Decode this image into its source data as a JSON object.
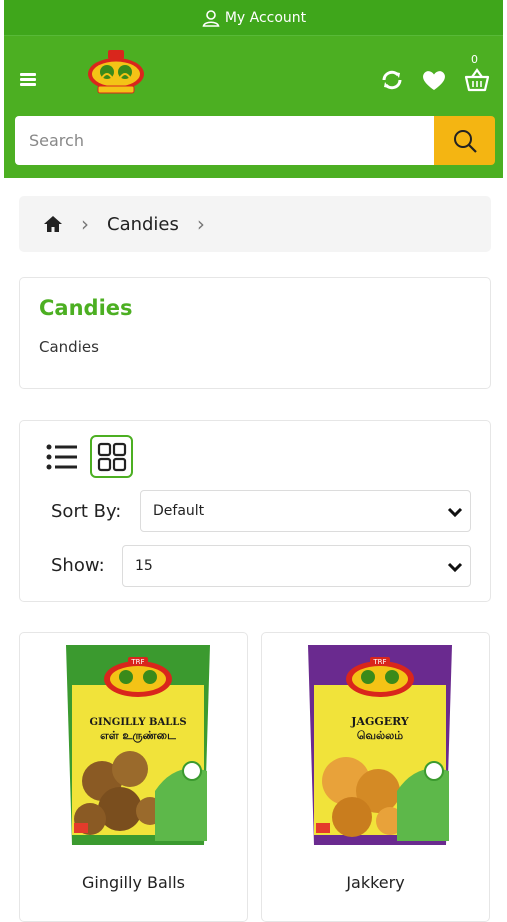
{
  "topbar": {
    "account_label": "My Account"
  },
  "header": {
    "cart_count": "0",
    "colors": {
      "brand_green": "#4caf22",
      "accent_yellow": "#f4b512"
    }
  },
  "search": {
    "placeholder": "Search"
  },
  "breadcrumb": {
    "items": [
      {
        "label": "Candies"
      }
    ]
  },
  "category": {
    "title": "Candies",
    "description": "Candies"
  },
  "toolbar": {
    "sort_label": "Sort By:",
    "sort_value": "Default",
    "show_label": "Show:",
    "show_value": "15"
  },
  "products": [
    {
      "name": "Gingilly Balls",
      "pack_brand": "TRF",
      "pack_title": "GINGILLY BALLS",
      "pack_subtitle": "எள் உருண்டை",
      "pack_color": "#3b9a2f"
    },
    {
      "name": "Jakkery",
      "pack_brand": "TRF",
      "pack_title": "JAGGERY",
      "pack_subtitle": "வெல்லம்",
      "pack_color": "#6a2a8f"
    }
  ]
}
